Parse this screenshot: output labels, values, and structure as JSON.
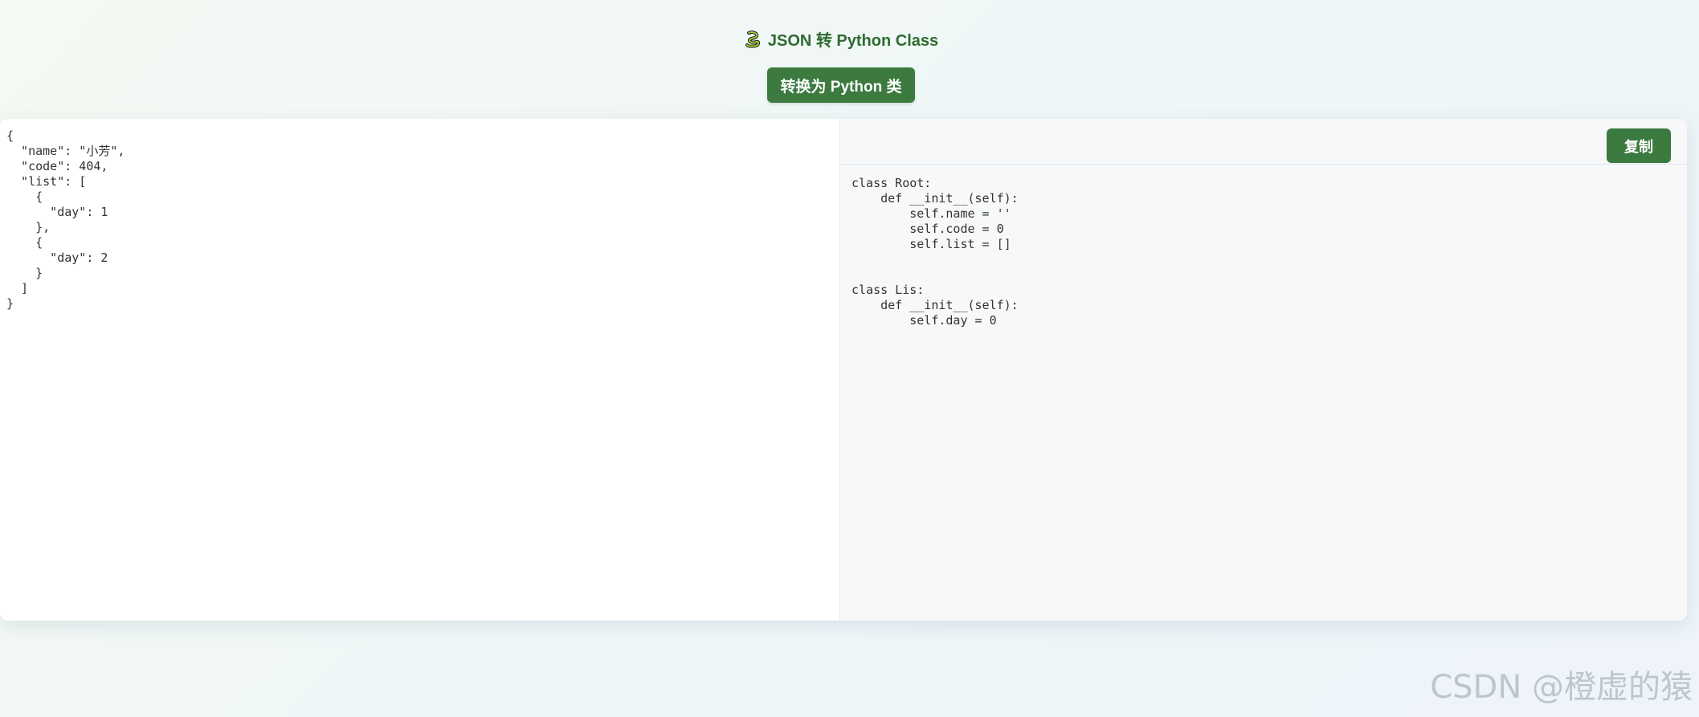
{
  "header": {
    "title": "JSON 转 Python Class",
    "icon": "snake-icon"
  },
  "actions": {
    "convert_label": "转换为 Python 类",
    "copy_label": "复制"
  },
  "editor": {
    "json_input": "{\n  \"name\": \"小芳\",\n  \"code\": 404,\n  \"list\": [\n    {\n      \"day\": 1\n    },\n    {\n      \"day\": 2\n    }\n  ]\n}"
  },
  "output": {
    "code": "class Root:\n    def __init__(self):\n        self.name = ''\n        self.code = 0\n        self.list = []\n\n\nclass Lis:\n    def __init__(self):\n        self.day = 0"
  },
  "watermark": "CSDN @橙虚的猿",
  "colors": {
    "accent": "#3c7a3f",
    "title": "#2f6b30",
    "output_bg": "#f6f8fa"
  }
}
